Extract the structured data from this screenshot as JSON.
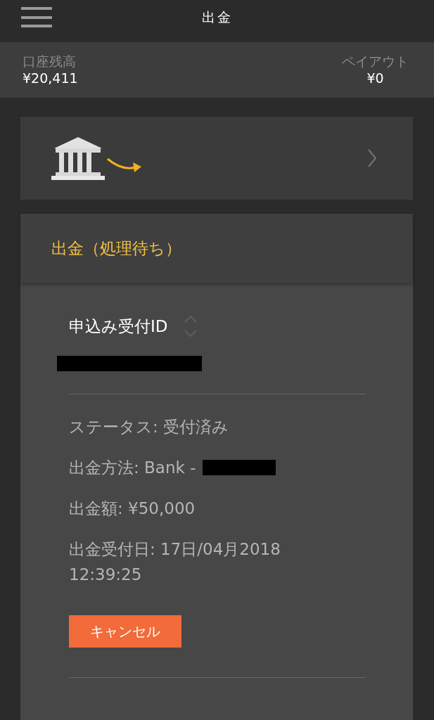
{
  "header": {
    "title": "出金"
  },
  "balance": {
    "account_label": "口座残高",
    "account_value": "¥20,411",
    "payout_label": "ペイアウト",
    "payout_value": "¥0"
  },
  "pending": {
    "title": "出金（処理待ち）",
    "id_label": "申込み受付ID",
    "details": [
      "ステータス: 受付済み",
      "出金方法: Bank -",
      "出金額: ¥50,000",
      "出金受付日: 17日/04月2018\n12:39:25"
    ],
    "cancel_button": "キャンセル"
  }
}
